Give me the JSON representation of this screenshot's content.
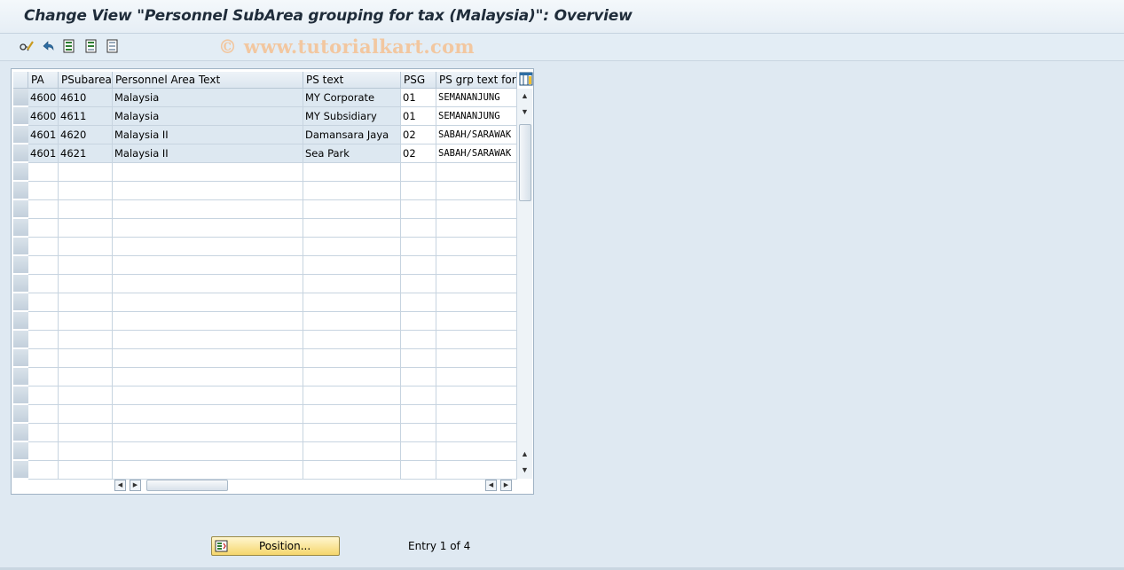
{
  "title": "Change View \"Personnel SubArea grouping for tax (Malaysia)\": Overview",
  "watermark": "© www.tutorialkart.com",
  "toolbar": {
    "icons": [
      "display-change-icon",
      "undo-icon",
      "select-all-icon",
      "select-block-icon",
      "deselect-all-icon"
    ]
  },
  "table": {
    "columns": [
      "PA",
      "PSubarea",
      "Personnel Area Text",
      "PS text",
      "PSG",
      "PS grp text for t"
    ],
    "rows": [
      [
        "4600",
        "4610",
        "Malaysia",
        "MY Corporate",
        "01",
        "SEMANANJUNG"
      ],
      [
        "4600",
        "4611",
        "Malaysia",
        "MY Subsidiary",
        "01",
        "SEMANANJUNG"
      ],
      [
        "4601",
        "4620",
        "Malaysia II",
        "Damansara Jaya",
        "02",
        "SABAH/SARAWAK"
      ],
      [
        "4601",
        "4621",
        "Malaysia II",
        "Sea Park",
        "02",
        "SABAH/SARAWAK"
      ]
    ]
  },
  "footer": {
    "position_label": "Position...",
    "entry_text": "Entry 1 of 4"
  }
}
